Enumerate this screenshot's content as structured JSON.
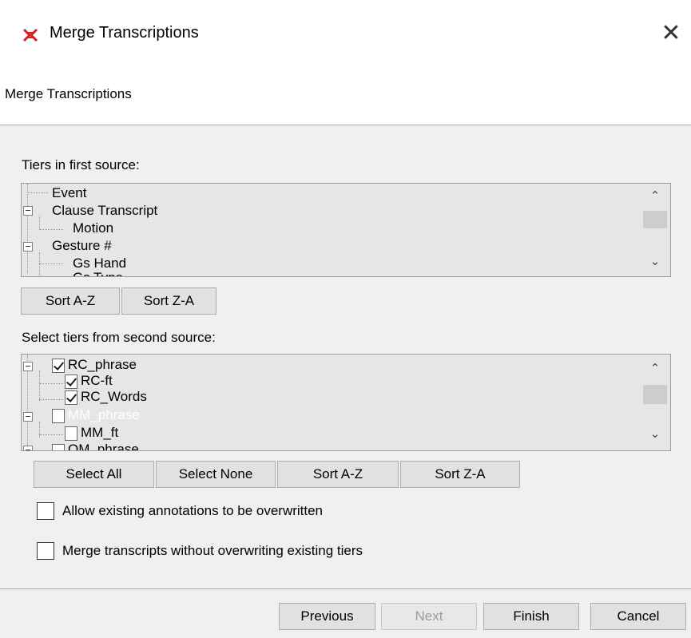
{
  "window": {
    "title": "Merge Transcriptions",
    "icon": "elan-icon",
    "close_glyph": "✕"
  },
  "header": {
    "title": "Merge Transcriptions"
  },
  "first_source": {
    "label": "Tiers in first source:",
    "tiers": [
      {
        "name": "Event",
        "level": 0,
        "expandable": false
      },
      {
        "name": "Clause Transcript",
        "level": 0,
        "expandable": true
      },
      {
        "name": "Motion",
        "level": 1,
        "expandable": false
      },
      {
        "name": "Gesture #",
        "level": 0,
        "expandable": true
      },
      {
        "name": "Gs Hand",
        "level": 1,
        "expandable": false
      },
      {
        "name": "Gs Type",
        "level": 1,
        "expandable": false
      }
    ],
    "sort_az": "Sort A-Z",
    "sort_za": "Sort Z-A"
  },
  "second_source": {
    "label": "Select tiers from second source:",
    "tiers": [
      {
        "name": "RC_phrase",
        "level": 0,
        "checked": true,
        "expandable": true
      },
      {
        "name": "RC-ft",
        "level": 1,
        "checked": true
      },
      {
        "name": "RC_Words",
        "level": 1,
        "checked": true
      },
      {
        "name": "MM_phrase",
        "level": 0,
        "checked": false,
        "expandable": true
      },
      {
        "name": "MM_ft",
        "level": 1,
        "checked": false
      },
      {
        "name": "OM_phrase",
        "level": 0,
        "checked": false,
        "expandable": true
      }
    ],
    "select_all": "Select All",
    "select_none": "Select None",
    "sort_az": "Sort A-Z",
    "sort_za": "Sort Z-A"
  },
  "options": {
    "allow_overwrite": "Allow existing annotations to be overwritten",
    "merge_without_overwrite": "Merge transcripts without overwriting existing tiers"
  },
  "footer": {
    "previous": "Previous",
    "next": "Next",
    "finish": "Finish",
    "cancel": "Cancel"
  },
  "icons": {
    "scroll_up": "^",
    "scroll_down": "v"
  }
}
